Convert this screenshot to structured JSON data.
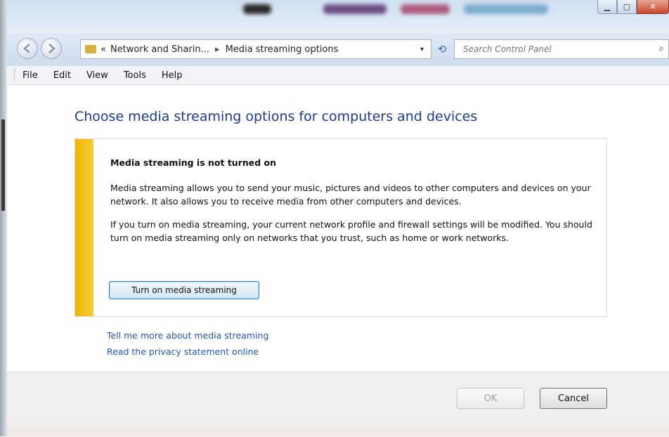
{
  "window": {
    "minimize_icon": "minimize-icon",
    "maximize_icon": "maximize-icon",
    "close_icon": "close-icon",
    "minimize_glyph": "▁",
    "maximize_glyph": "▢",
    "close_glyph": "✕"
  },
  "navigation": {
    "back_icon": "back-arrow-icon",
    "forward_icon": "forward-arrow-icon",
    "address_prefix": "«",
    "breadcrumb_1": "Network and Sharin...",
    "breadcrumb_separator": "▸",
    "breadcrumb_2": "Media streaming options",
    "dropdown_glyph": "▾",
    "refresh_glyph": "⟲",
    "search_placeholder": "Search Control Panel",
    "search_glyph": "⌕"
  },
  "menu": {
    "file": "File",
    "edit": "Edit",
    "view": "View",
    "tools": "Tools",
    "help": "Help"
  },
  "main": {
    "heading": "Choose media streaming options for computers and devices",
    "panel": {
      "title": "Media streaming is not turned on",
      "paragraph_1": "Media streaming allows you to send your music, pictures and videos to other computers and devices on your network.  It also allows you to receive media from other computers and devices.",
      "paragraph_2": "If you turn on media streaming, your current network profile and firewall settings will be modified. You should turn on media streaming only on networks that you trust, such as home or work networks.",
      "button_label": "Turn on media streaming",
      "stripe_color": "#f0b400"
    },
    "links": {
      "tell_more": "Tell me more about media streaming",
      "privacy": "Read the privacy statement online"
    }
  },
  "footer": {
    "ok_label": "OK",
    "cancel_label": "Cancel"
  },
  "colors": {
    "heading": "#1e3c8c",
    "link": "#1f57b5",
    "accent_stripe": "#f0b400"
  }
}
